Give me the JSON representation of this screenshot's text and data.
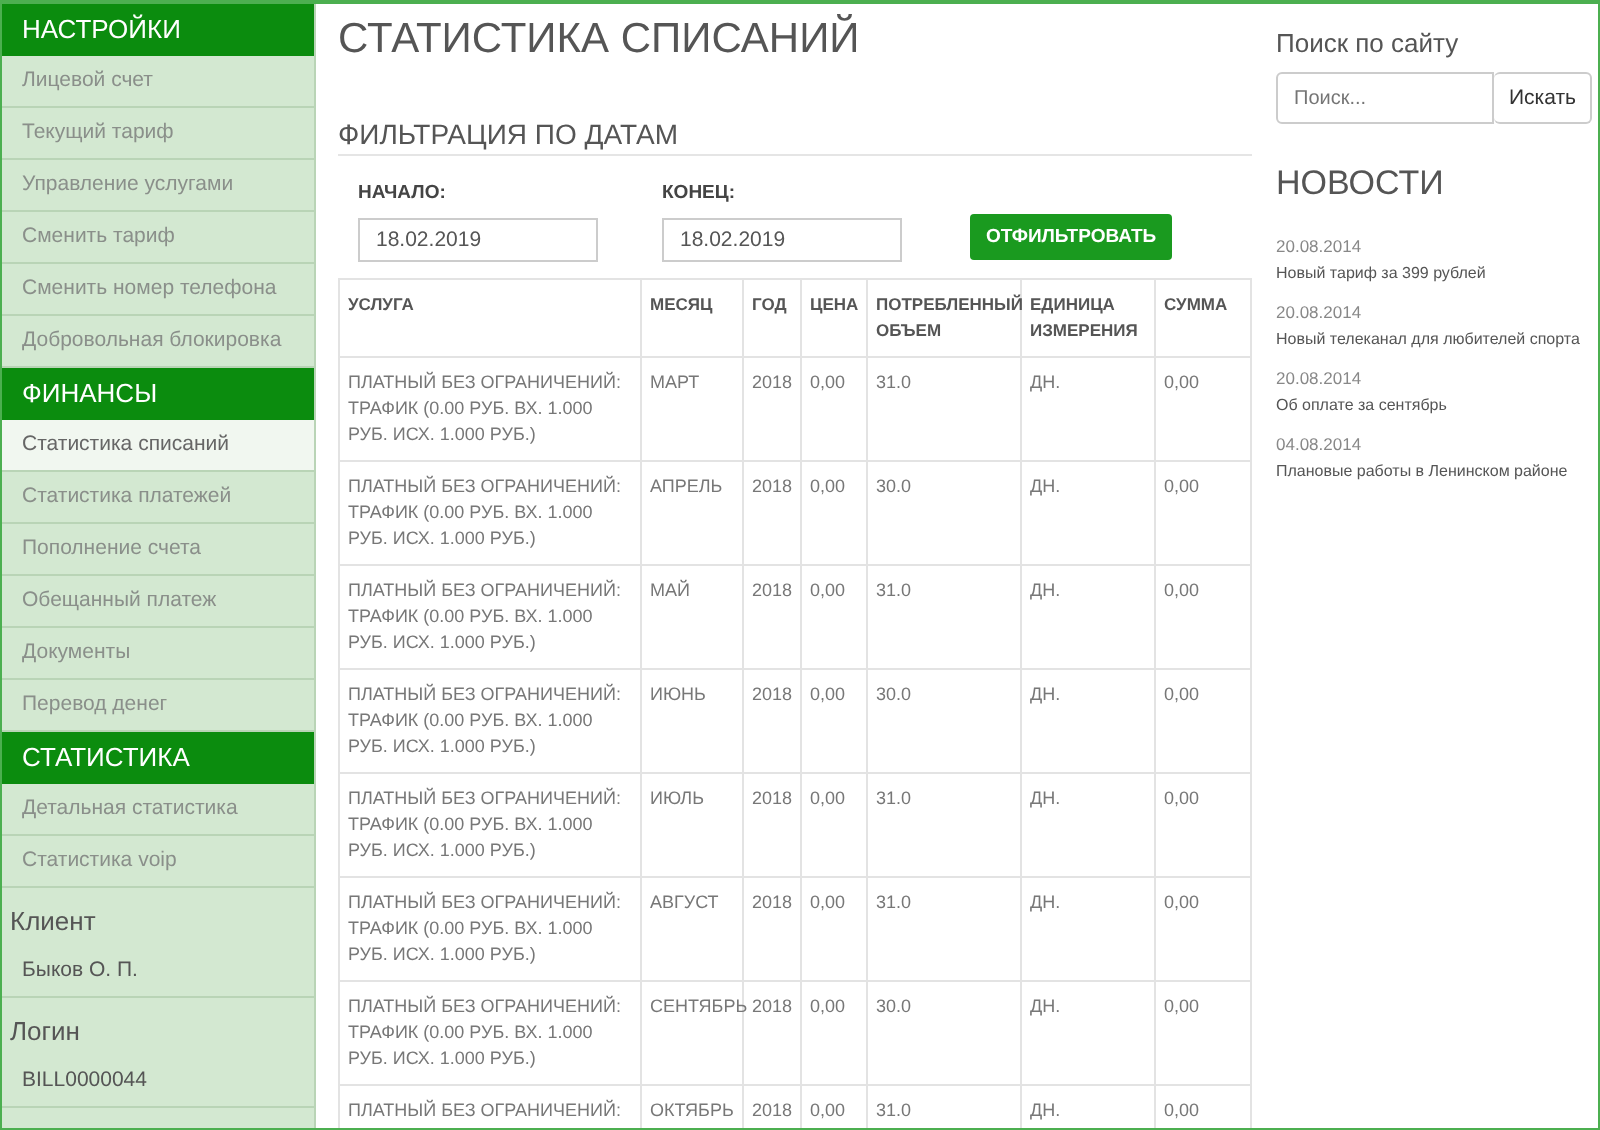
{
  "sidebar": {
    "sections": [
      {
        "title": "НАСТРОЙКИ",
        "items": [
          {
            "label": "Лицевой счет",
            "selected": false
          },
          {
            "label": "Текущий тариф",
            "selected": false
          },
          {
            "label": "Управление услугами",
            "selected": false
          },
          {
            "label": "Сменить тариф",
            "selected": false
          },
          {
            "label": "Сменить номер телефона",
            "selected": false
          },
          {
            "label": "Добровольная блокировка",
            "selected": false
          }
        ]
      },
      {
        "title": "ФИНАНСЫ",
        "items": [
          {
            "label": "Статистика списаний",
            "selected": true
          },
          {
            "label": "Статистика платежей",
            "selected": false
          },
          {
            "label": "Пополнение счета",
            "selected": false
          },
          {
            "label": "Обещанный платеж",
            "selected": false
          },
          {
            "label": "Документы",
            "selected": false
          },
          {
            "label": "Перевод денег",
            "selected": false
          }
        ]
      },
      {
        "title": "СТАТИСТИКА",
        "items": [
          {
            "label": "Детальная статистика",
            "selected": false
          },
          {
            "label": "Статистика voip",
            "selected": false
          }
        ]
      }
    ],
    "info": [
      {
        "label": "Клиент",
        "value": "Быков О. П."
      },
      {
        "label": "Логин",
        "value": "BILL0000044"
      }
    ]
  },
  "page_title": "СТАТИСТИКА СПИСАНИЙ",
  "filter": {
    "title": "ФИЛЬТРАЦИЯ ПО ДАТАМ",
    "start_label": "НАЧАЛО:",
    "start_value": "18.02.2019",
    "end_label": "КОНЕЦ:",
    "end_value": "18.02.2019",
    "button": "ОТФИЛЬТРОВАТЬ"
  },
  "table": {
    "columns": [
      "УСЛУГА",
      "МЕСЯЦ",
      "ГОД",
      "ЦЕНА",
      "ПОТРЕБЛЕННЫЙ ОБЪЕМ",
      "ЕДИНИЦА ИЗМЕРЕНИЯ",
      "СУММА"
    ],
    "rows": [
      [
        "ПЛАТНЫЙ БЕЗ ОГРАНИЧЕНИЙ: ТРАФИК (0.00 РУБ. ВХ. 1.000 РУБ. ИСХ. 1.000 РУБ.)",
        "МАРТ",
        "2018",
        "0,00",
        "31.0",
        "ДН.",
        "0,00"
      ],
      [
        "ПЛАТНЫЙ БЕЗ ОГРАНИЧЕНИЙ: ТРАФИК (0.00 РУБ. ВХ. 1.000 РУБ. ИСХ. 1.000 РУБ.)",
        "АПРЕЛЬ",
        "2018",
        "0,00",
        "30.0",
        "ДН.",
        "0,00"
      ],
      [
        "ПЛАТНЫЙ БЕЗ ОГРАНИЧЕНИЙ: ТРАФИК (0.00 РУБ. ВХ. 1.000 РУБ. ИСХ. 1.000 РУБ.)",
        "МАЙ",
        "2018",
        "0,00",
        "31.0",
        "ДН.",
        "0,00"
      ],
      [
        "ПЛАТНЫЙ БЕЗ ОГРАНИЧЕНИЙ: ТРАФИК (0.00 РУБ. ВХ. 1.000 РУБ. ИСХ. 1.000 РУБ.)",
        "ИЮНЬ",
        "2018",
        "0,00",
        "30.0",
        "ДН.",
        "0,00"
      ],
      [
        "ПЛАТНЫЙ БЕЗ ОГРАНИЧЕНИЙ: ТРАФИК (0.00 РУБ. ВХ. 1.000 РУБ. ИСХ. 1.000 РУБ.)",
        "ИЮЛЬ",
        "2018",
        "0,00",
        "31.0",
        "ДН.",
        "0,00"
      ],
      [
        "ПЛАТНЫЙ БЕЗ ОГРАНИЧЕНИЙ: ТРАФИК (0.00 РУБ. ВХ. 1.000 РУБ. ИСХ. 1.000 РУБ.)",
        "АВГУСТ",
        "2018",
        "0,00",
        "31.0",
        "ДН.",
        "0,00"
      ],
      [
        "ПЛАТНЫЙ БЕЗ ОГРАНИЧЕНИЙ: ТРАФИК (0.00 РУБ. ВХ. 1.000 РУБ. ИСХ. 1.000 РУБ.)",
        "СЕНТЯБРЬ",
        "2018",
        "0,00",
        "30.0",
        "ДН.",
        "0,00"
      ],
      [
        "ПЛАТНЫЙ БЕЗ ОГРАНИЧЕНИЙ:",
        "ОКТЯБРЬ",
        "2018",
        "0,00",
        "31.0",
        "ДН.",
        "0,00"
      ]
    ]
  },
  "search": {
    "title": "Поиск по сайту",
    "placeholder": "Поиск...",
    "button": "Искать"
  },
  "news": {
    "title": "НОВОСТИ",
    "items": [
      {
        "date": "20.08.2014",
        "title": "Новый тариф за 399 рублей"
      },
      {
        "date": "20.08.2014",
        "title": "Новый телеканал для любителей спорта"
      },
      {
        "date": "20.08.2014",
        "title": "Об оплате за сентябрь"
      },
      {
        "date": "04.08.2014",
        "title": "Плановые работы в Ленинском районе"
      }
    ]
  }
}
